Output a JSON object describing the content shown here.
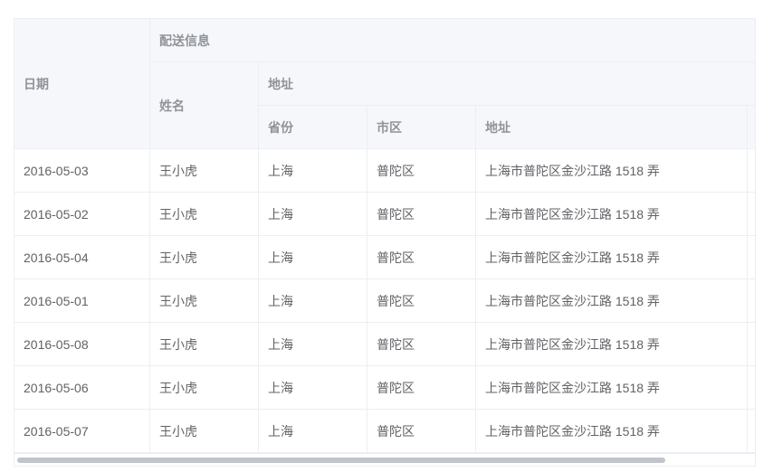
{
  "table": {
    "headers": {
      "date": "日期",
      "delivery": "配送信息",
      "name": "姓名",
      "address_group": "地址",
      "province": "省份",
      "city": "市区",
      "address": "地址"
    },
    "rows": [
      {
        "date": "2016-05-03",
        "name": "王小虎",
        "province": "上海",
        "city": "普陀区",
        "address": "上海市普陀区金沙江路 1518 弄"
      },
      {
        "date": "2016-05-02",
        "name": "王小虎",
        "province": "上海",
        "city": "普陀区",
        "address": "上海市普陀区金沙江路 1518 弄"
      },
      {
        "date": "2016-05-04",
        "name": "王小虎",
        "province": "上海",
        "city": "普陀区",
        "address": "上海市普陀区金沙江路 1518 弄"
      },
      {
        "date": "2016-05-01",
        "name": "王小虎",
        "province": "上海",
        "city": "普陀区",
        "address": "上海市普陀区金沙江路 1518 弄"
      },
      {
        "date": "2016-05-08",
        "name": "王小虎",
        "province": "上海",
        "city": "普陀区",
        "address": "上海市普陀区金沙江路 1518 弄"
      },
      {
        "date": "2016-05-06",
        "name": "王小虎",
        "province": "上海",
        "city": "普陀区",
        "address": "上海市普陀区金沙江路 1518 弄"
      },
      {
        "date": "2016-05-07",
        "name": "王小虎",
        "province": "上海",
        "city": "普陀区",
        "address": "上海市普陀区金沙江路 1518 弄"
      }
    ]
  },
  "colors": {
    "header_bg": "#f5f7fa",
    "border": "#ebeef5",
    "header_text": "#909399",
    "body_text": "#606266",
    "scrollbar": "#c0c4cc"
  }
}
